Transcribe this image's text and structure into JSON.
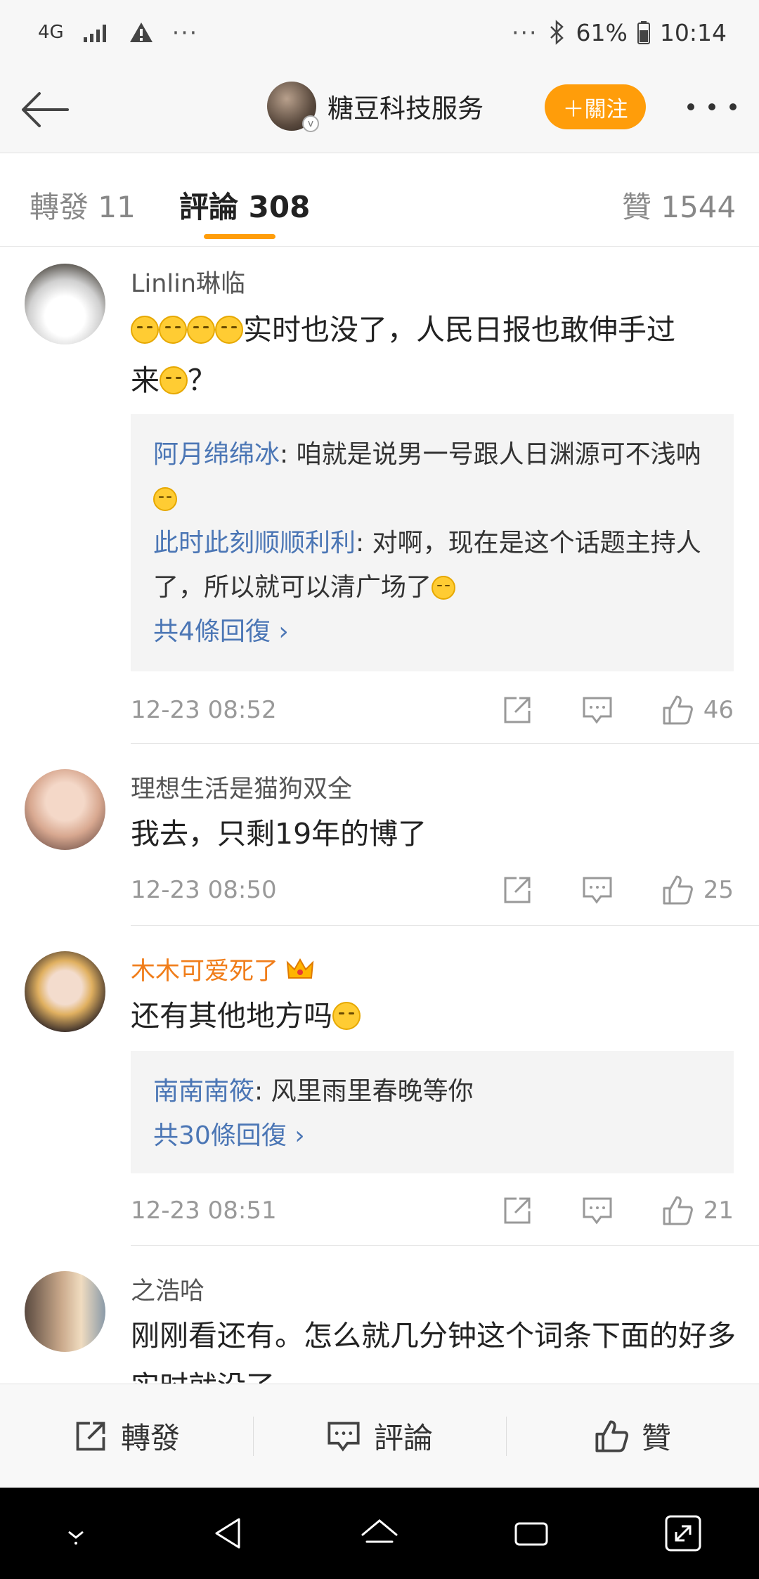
{
  "status_bar": {
    "network": "4G",
    "dots_left": "···",
    "dots_right": "···",
    "battery": "61%",
    "time": "10:14",
    "icons": [
      "signal-icon",
      "warning-icon",
      "bluetooth-icon",
      "battery-icon"
    ]
  },
  "header": {
    "name": "糖豆科技服务",
    "follow_label": "＋關注"
  },
  "tabs": {
    "repost": "轉發 11",
    "comments": "評論 308",
    "likes": "贊 1544"
  },
  "comments": [
    {
      "user": "Linlin琳临",
      "text_after_emoji": "实时也没了，人民日报也敢伸手过",
      "text_line2_start": "来",
      "text_line2_end": "？",
      "replies": [
        {
          "name": "阿月绵绵冰",
          "text": ": 咱就是说男一号跟人日渊源可不浅呐"
        },
        {
          "name": "此时此刻顺顺利利",
          "text": ": 对啊，现在是这个话题主持人了，所以就可以清广场了"
        }
      ],
      "more_replies": "共4條回復 ›",
      "time": "12-23 08:52",
      "likes": "46"
    },
    {
      "user": "理想生活是猫狗双全",
      "text": "我去，只剩19年的博了",
      "time": "12-23 08:50",
      "likes": "25"
    },
    {
      "user": "木木可爱死了",
      "text": "还有其他地方吗",
      "replies": [
        {
          "name": "南南南筱",
          "text": ": 风里雨里春晚等你"
        }
      ],
      "more_replies": "共30條回復 ›",
      "time": "12-23 08:51",
      "likes": "21",
      "user_color": "#f07d1a"
    },
    {
      "user": "之浩哈",
      "text": "刚刚看还有。怎么就几分钟这个词条下面的好多实时就没了"
    }
  ],
  "bottom_bar": {
    "repost": "轉發",
    "comment": "評論",
    "like": "贊"
  },
  "colors": {
    "accent": "#ff9d0a",
    "link": "#4b76b5"
  }
}
